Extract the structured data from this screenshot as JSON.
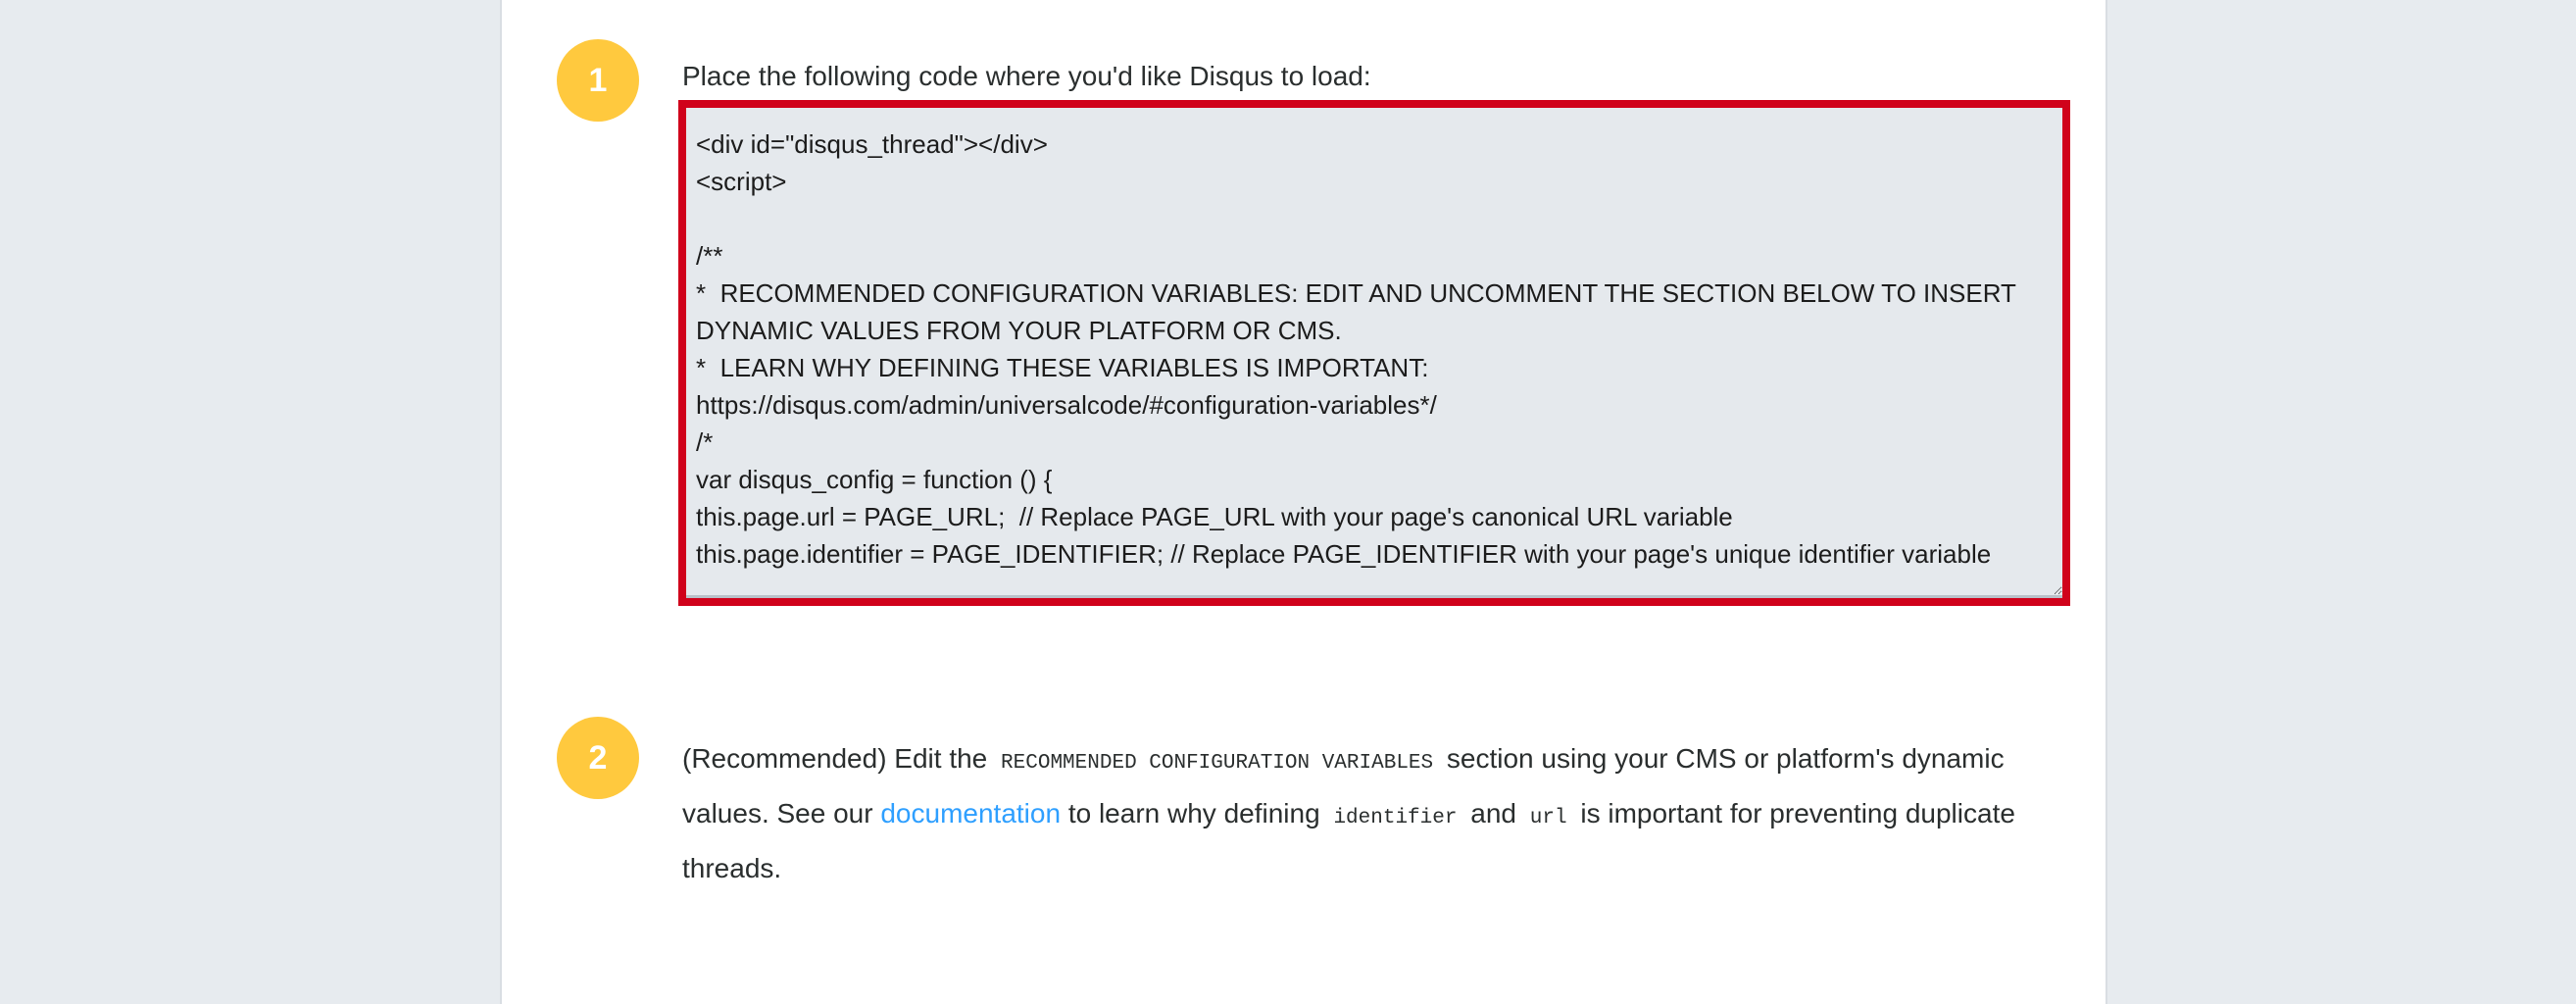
{
  "steps": [
    {
      "number": "1",
      "title": "Place the following code where you'd like Disqus to load:",
      "code": "<div id=\"disqus_thread\"></div>\n<script>\n\n/**\n*  RECOMMENDED CONFIGURATION VARIABLES: EDIT AND UNCOMMENT THE SECTION BELOW TO INSERT DYNAMIC VALUES FROM YOUR PLATFORM OR CMS.\n*  LEARN WHY DEFINING THESE VARIABLES IS IMPORTANT: https://disqus.com/admin/universalcode/#configuration-variables*/\n/*\nvar disqus_config = function () {\nthis.page.url = PAGE_URL;  // Replace PAGE_URL with your page's canonical URL variable\nthis.page.identifier = PAGE_IDENTIFIER; // Replace PAGE_IDENTIFIER with your page's unique identifier variable"
    },
    {
      "number": "2",
      "text_1": "(Recommended) Edit the",
      "code_1": "RECOMMENDED CONFIGURATION VARIABLES",
      "text_2": "section using your CMS or platform's dynamic values. See our",
      "link": "documentation",
      "text_3": "to learn why defining",
      "code_2": "identifier",
      "text_4": "and",
      "code_3": "url",
      "text_5": "is important for preventing duplicate threads."
    }
  ],
  "colors": {
    "accent_yellow": "#ffc93e",
    "highlight_red": "#d0021b",
    "link_blue": "#2e9fff"
  }
}
